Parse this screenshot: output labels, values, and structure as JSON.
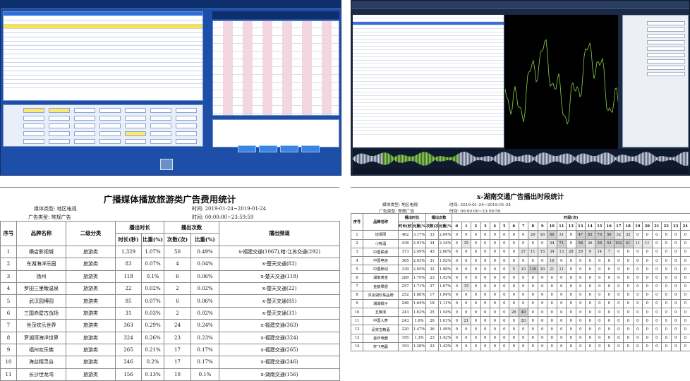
{
  "report_left": {
    "title": "广播媒体播放旅游类广告费用统计",
    "media_type": "媒体类型: 地区电视",
    "ad_type": "广告类型: 常规广告",
    "time_date": "时间: 2019-01-24~2019-01-24",
    "time_range": "时间: 00:00:00~23:59:59",
    "headers": {
      "seq": "序号",
      "brand": "品牌名称",
      "category": "二级分类",
      "duration_group": "播出时长",
      "count_group": "播出次数",
      "channel": "播出频道",
      "duration_sec": "时长(秒)",
      "ratio": "比重(%)",
      "times": "次数(次)"
    },
    "rows": [
      {
        "seq": "1",
        "brand": "横店影视城",
        "category": "旅游类",
        "dur": "1,329",
        "dur_pct": "1.07%",
        "cnt": "50",
        "cnt_pct": "0.49%",
        "channel": "x-福建交通(1067),暗-江苏交通(292)"
      },
      {
        "seq": "2",
        "brand": "东湖海洋乐园",
        "category": "旅游类",
        "dur": "83",
        "dur_pct": "0.07%",
        "cnt": "4",
        "cnt_pct": "0.04%",
        "channel": "x-楚天交通(83)"
      },
      {
        "seq": "3",
        "brand": "扬州",
        "category": "旅游类",
        "dur": "118",
        "dur_pct": "0.1%",
        "cnt": "6",
        "cnt_pct": "0.06%",
        "channel": "x-楚天交通(118)"
      },
      {
        "seq": "4",
        "brand": "罗田三里畈温泉",
        "category": "旅游类",
        "dur": "22",
        "dur_pct": "0.02%",
        "cnt": "2",
        "cnt_pct": "0.02%",
        "channel": "x-楚天交通(22)"
      },
      {
        "seq": "5",
        "brand": "武汉园博园",
        "category": "旅游类",
        "dur": "85",
        "dur_pct": "0.07%",
        "cnt": "6",
        "cnt_pct": "0.06%",
        "channel": "x-楚天交通(85)"
      },
      {
        "seq": "6",
        "brand": "三国赤壁古战场",
        "category": "旅游类",
        "dur": "31",
        "dur_pct": "0.03%",
        "cnt": "2",
        "cnt_pct": "0.02%",
        "channel": "x-楚天交通(31)"
      },
      {
        "seq": "7",
        "brand": "世茂欢乐世界",
        "category": "旅游类",
        "dur": "363",
        "dur_pct": "0.29%",
        "cnt": "24",
        "cnt_pct": "0.24%",
        "channel": "x-福建交通(363)"
      },
      {
        "seq": "8",
        "brand": "罗湖湾海洋世界",
        "category": "旅游类",
        "dur": "324",
        "dur_pct": "0.26%",
        "cnt": "23",
        "cnt_pct": "0.23%",
        "channel": "x-福建交通(324)"
      },
      {
        "seq": "9",
        "brand": "福州欢乐佛",
        "category": "旅游类",
        "dur": "265",
        "dur_pct": "0.21%",
        "cnt": "17",
        "cnt_pct": "0.17%",
        "channel": "x-福建交通(265)"
      },
      {
        "seq": "10",
        "brand": "海丝精灵谷",
        "category": "旅游类",
        "dur": "246",
        "dur_pct": "0.2%",
        "cnt": "17",
        "cnt_pct": "0.17%",
        "channel": "x-福建交通(246)"
      },
      {
        "seq": "11",
        "brand": "长沙世龙湾",
        "category": "旅游类",
        "dur": "156",
        "dur_pct": "0.13%",
        "cnt": "10",
        "cnt_pct": "0.1%",
        "channel": "x-湖南交通(156)"
      }
    ]
  },
  "report_right": {
    "title": "x-湖南交通广告播出时段统计",
    "media_type": "媒体类型: 地区电视",
    "ad_type": "广告类型: 常规广告",
    "time_date": "时间: 2019-01-24~2019-01-24",
    "time_range": "时间: 00:00:00~23:59:59",
    "headers": {
      "seq": "序号",
      "brand": "品牌名称",
      "duration_group": "播出时长",
      "count_group": "播出次数",
      "period": "时段(次)",
      "duration_sec": "时长(秒)",
      "ratio": "比重(%)",
      "times": "次数(次)",
      "hours": [
        "0",
        "1",
        "2",
        "3",
        "4",
        "5",
        "6",
        "7",
        "8",
        "9",
        "10",
        "11",
        "12",
        "13",
        "14",
        "15",
        "16",
        "17",
        "18",
        "19",
        "20",
        "21",
        "22",
        "23",
        "24"
      ]
    },
    "rows": [
      {
        "seq": "1",
        "brand": "饶贤网",
        "dur": "462",
        "dur_pct": "3.17%",
        "cnt": "33",
        "cnt_pct": "2.04%",
        "hours": [
          "0",
          "0",
          "0",
          "0",
          "0",
          "0",
          "0",
          "0",
          "20",
          "16",
          "66",
          "31",
          "0",
          "47",
          "83",
          "79",
          "56",
          "32",
          "32",
          "0",
          "0",
          "0",
          "0",
          "0",
          "0"
        ]
      },
      {
        "seq": "2",
        "brand": "小熊酒",
        "dur": "438",
        "dur_pct": "2.91%",
        "cnt": "34",
        "cnt_pct": "2.34%",
        "hours": [
          "0",
          "35",
          "0",
          "0",
          "0",
          "0",
          "0",
          "0",
          "0",
          "0",
          "34",
          "71",
          "0",
          "98",
          "26",
          "58",
          "53",
          "102",
          "41",
          "11",
          "11",
          "0",
          "0",
          "0",
          "0"
        ]
      },
      {
        "seq": "3",
        "brand": "中国联通",
        "dur": "373",
        "dur_pct": "2.49%",
        "cnt": "43",
        "cnt_pct": "2.68%",
        "hours": [
          "0",
          "0",
          "0",
          "0",
          "0",
          "0",
          "0",
          "27",
          "11",
          "15",
          "34",
          "13",
          "28",
          "29",
          "9",
          "14",
          "7",
          "0",
          "0",
          "0",
          "0",
          "0",
          "0",
          "0",
          "0"
        ]
      },
      {
        "seq": "4",
        "brand": "中国电信",
        "dur": "365",
        "dur_pct": "2.03%",
        "cnt": "31",
        "cnt_pct": "1.92%",
        "hours": [
          "0",
          "0",
          "0",
          "0",
          "0",
          "0",
          "0",
          "0",
          "0",
          "0",
          "16",
          "0",
          "0",
          "0",
          "0",
          "0",
          "0",
          "0",
          "0",
          "0",
          "0",
          "0",
          "0",
          "0",
          "0"
        ]
      },
      {
        "seq": "5",
        "brand": "中国移动",
        "dur": "339",
        "dur_pct": "2.05%",
        "cnt": "32",
        "cnt_pct": "1.98%",
        "hours": [
          "0",
          "0",
          "0",
          "0",
          "0",
          "0",
          "5",
          "10",
          "120",
          "20",
          "21",
          "11",
          "0",
          "0",
          "0",
          "0",
          "0",
          "0",
          "0",
          "0",
          "0",
          "0",
          "0",
          "0",
          "0"
        ]
      },
      {
        "seq": "6",
        "brand": "湖南黄金",
        "dur": "289",
        "dur_pct": "1.79%",
        "cnt": "23",
        "cnt_pct": "1.42%",
        "hours": [
          "0",
          "0",
          "0",
          "0",
          "0",
          "0",
          "0",
          "0",
          "0",
          "0",
          "0",
          "0",
          "0",
          "0",
          "0",
          "0",
          "0",
          "0",
          "0",
          "0",
          "0",
          "0",
          "0",
          "0",
          "0"
        ]
      },
      {
        "seq": "7",
        "brand": "金鹤果肥",
        "dur": "257",
        "dur_pct": "1.71%",
        "cnt": "27",
        "cnt_pct": "1.67%",
        "hours": [
          "0",
          "15",
          "0",
          "0",
          "0",
          "0",
          "0",
          "0",
          "0",
          "0",
          "0",
          "0",
          "0",
          "0",
          "0",
          "0",
          "0",
          "0",
          "0",
          "0",
          "0",
          "0",
          "0",
          "0",
          "0"
        ]
      },
      {
        "seq": "8",
        "brand": "洪凉湖珍珠品牌",
        "dur": "252",
        "dur_pct": "1.68%",
        "cnt": "17",
        "cnt_pct": "1.04%",
        "hours": [
          "0",
          "0",
          "0",
          "0",
          "0",
          "0",
          "0",
          "0",
          "0",
          "0",
          "0",
          "0",
          "0",
          "0",
          "0",
          "0",
          "0",
          "0",
          "0",
          "0",
          "0",
          "0",
          "0",
          "0",
          "0"
        ]
      },
      {
        "seq": "9",
        "brand": "湘湖橘子",
        "dur": "246",
        "dur_pct": "1.64%",
        "cnt": "18",
        "cnt_pct": "1.11%",
        "hours": [
          "0",
          "0",
          "0",
          "0",
          "0",
          "0",
          "0",
          "0",
          "0",
          "0",
          "0",
          "0",
          "0",
          "0",
          "0",
          "0",
          "0",
          "0",
          "0",
          "0",
          "0",
          "0",
          "0",
          "0",
          "0"
        ]
      },
      {
        "seq": "10",
        "brand": "五粮液",
        "dur": "243",
        "dur_pct": "1.62%",
        "cnt": "25",
        "cnt_pct": "1.54%",
        "hours": [
          "0",
          "0",
          "0",
          "0",
          "0",
          "0",
          "26",
          "49",
          "0",
          "0",
          "0",
          "0",
          "0",
          "0",
          "0",
          "0",
          "0",
          "0",
          "0",
          "0",
          "0",
          "0",
          "0",
          "0",
          "0"
        ]
      },
      {
        "seq": "11",
        "brand": "中国人寿",
        "dur": "243",
        "dur_pct": "1.6%",
        "cnt": "26",
        "cnt_pct": "1.61%",
        "hours": [
          "0",
          "21",
          "0",
          "0",
          "0",
          "0",
          "0",
          "20",
          "0",
          "0",
          "0",
          "0",
          "0",
          "0",
          "0",
          "0",
          "0",
          "0",
          "0",
          "0",
          "0",
          "0",
          "0",
          "0",
          "0"
        ]
      },
      {
        "seq": "12",
        "brand": "泥浆宝精酒",
        "dur": "220",
        "dur_pct": "1.47%",
        "cnt": "26",
        "cnt_pct": "1.49%",
        "hours": [
          "0",
          "0",
          "0",
          "0",
          "0",
          "0",
          "0",
          "0",
          "0",
          "0",
          "0",
          "0",
          "0",
          "0",
          "0",
          "0",
          "0",
          "0",
          "0",
          "0",
          "0",
          "0",
          "0",
          "0",
          "0"
        ]
      },
      {
        "seq": "13",
        "brand": "金杯电器",
        "dur": "195",
        "dur_pct": "1.3%",
        "cnt": "23",
        "cnt_pct": "1.42%",
        "hours": [
          "0",
          "0",
          "0",
          "0",
          "0",
          "0",
          "0",
          "0",
          "0",
          "0",
          "0",
          "0",
          "0",
          "0",
          "0",
          "0",
          "0",
          "0",
          "0",
          "0",
          "0",
          "0",
          "0",
          "0",
          "0"
        ]
      },
      {
        "seq": "14",
        "brand": "轩飞电器",
        "dur": "193",
        "dur_pct": "1.28%",
        "cnt": "23",
        "cnt_pct": "1.42%",
        "hours": [
          "0",
          "0",
          "0",
          "0",
          "0",
          "0",
          "0",
          "0",
          "0",
          "0",
          "0",
          "0",
          "0",
          "0",
          "0",
          "0",
          "0",
          "0",
          "0",
          "0",
          "0",
          "0",
          "0",
          "0",
          "0"
        ]
      }
    ]
  },
  "colors": {
    "app_blue": "#1d4fa8",
    "highlight_yellow": "#ffe33a",
    "dark_app": "#1b2a44",
    "waveform": "#8bd24a",
    "cell_shade": "#cfcfcf"
  }
}
